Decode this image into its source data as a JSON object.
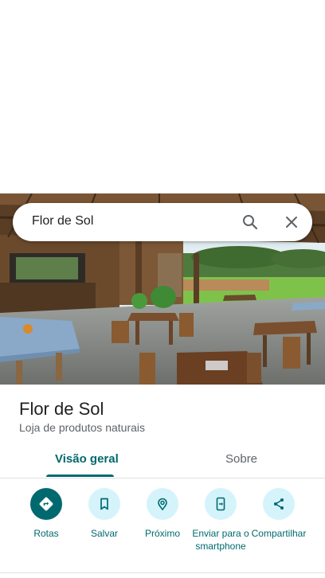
{
  "search": {
    "query": "Flor de Sol"
  },
  "icons": {
    "search": "search-icon",
    "close": "close-icon",
    "directions": "directions-icon",
    "save": "bookmark-icon",
    "nearby": "nearby-icon",
    "send": "send-to-phone-icon",
    "share": "share-icon"
  },
  "place": {
    "name": "Flor de Sol",
    "category": "Loja de produtos naturais"
  },
  "tabs": [
    {
      "label": "Visão geral",
      "active": true
    },
    {
      "label": "Sobre",
      "active": false
    }
  ],
  "actions": [
    {
      "label": "Rotas"
    },
    {
      "label": "Salvar"
    },
    {
      "label": "Próximo"
    },
    {
      "label": "Enviar para o smartphone"
    },
    {
      "label": "Compartilhar"
    }
  ],
  "colors": {
    "accent": "#00696f",
    "action_bg": "#d5f3fb",
    "text_primary": "#202124",
    "text_secondary": "#5f6368"
  }
}
